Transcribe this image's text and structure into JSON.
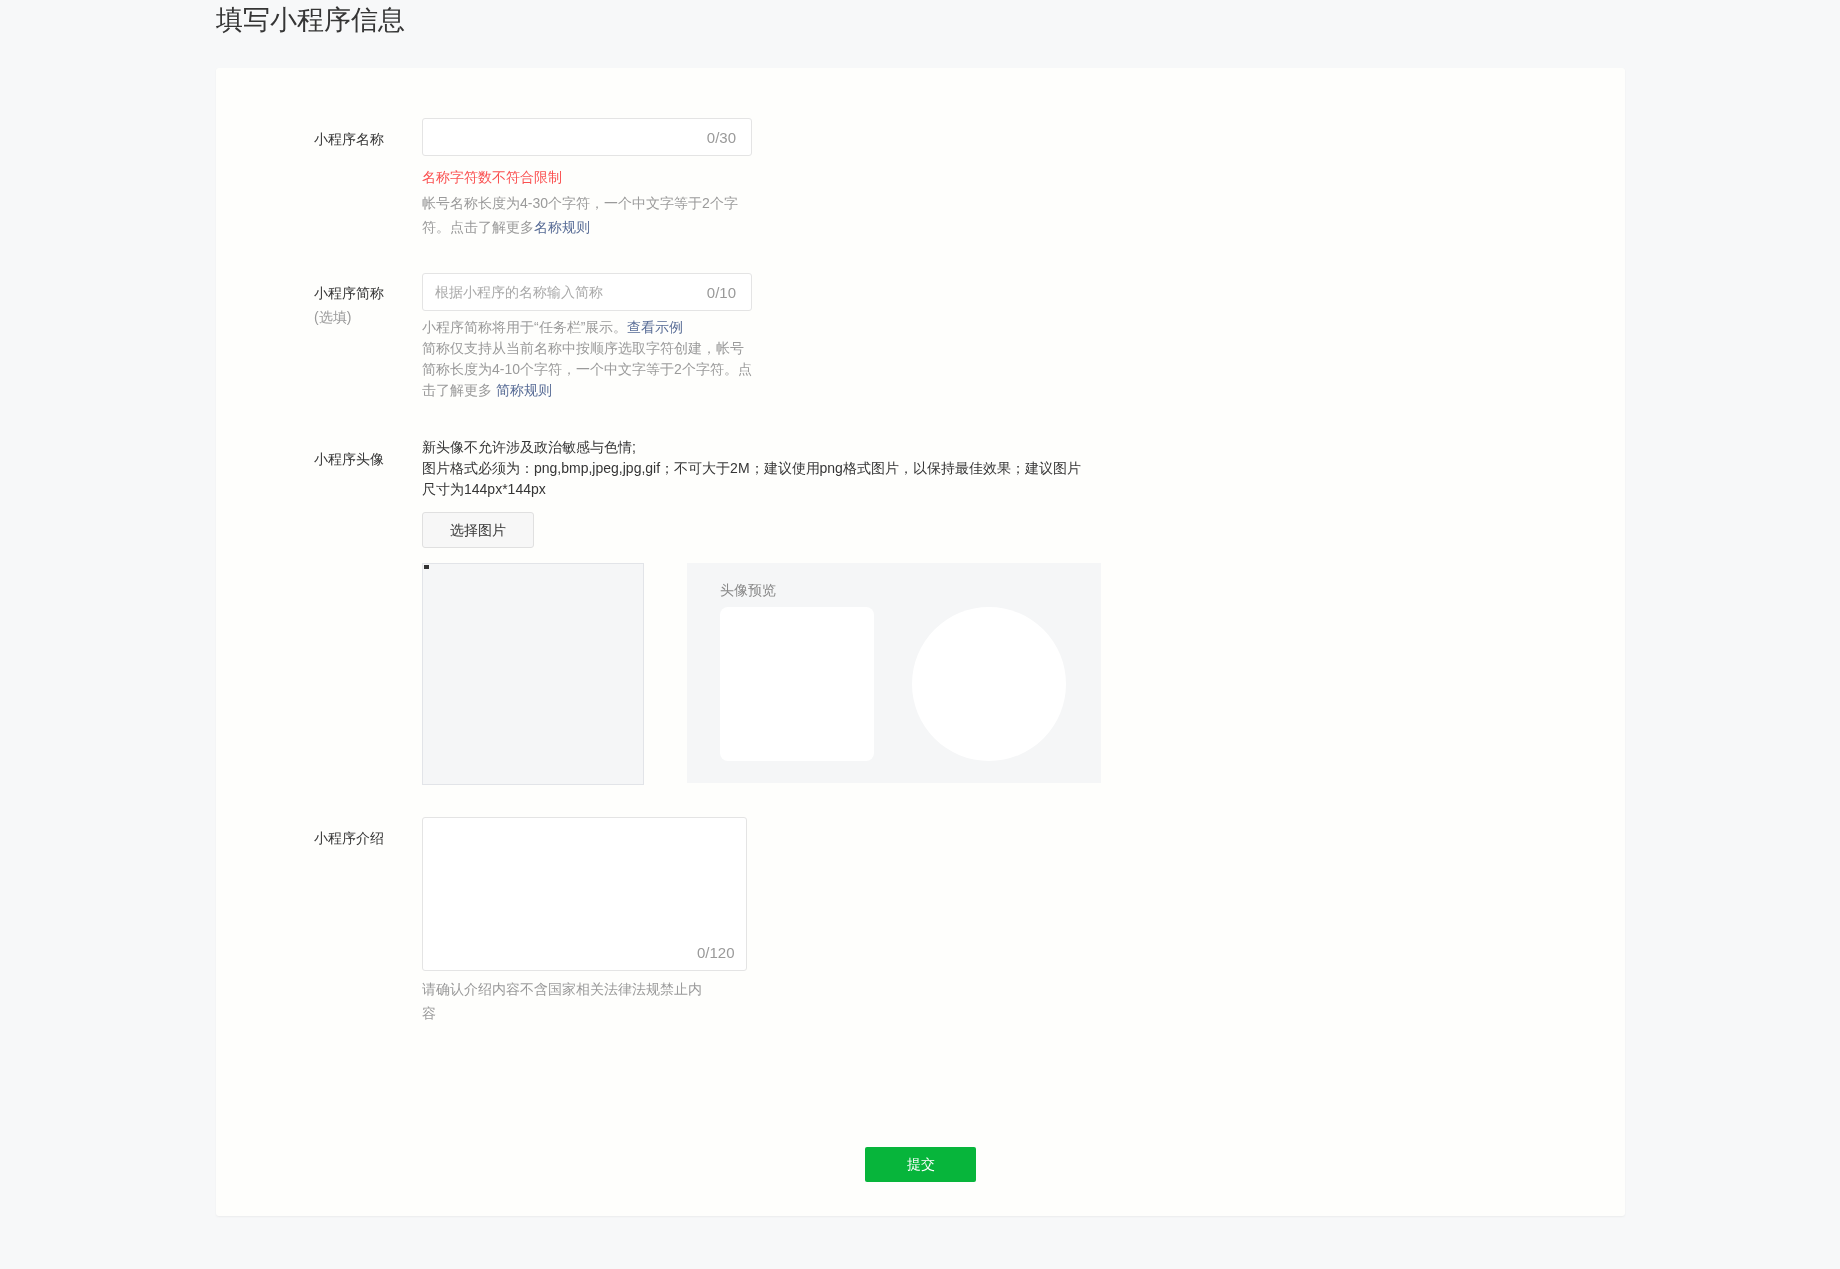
{
  "page_title": "填写小程序信息",
  "name_field": {
    "label": "小程序名称",
    "counter": "0/30",
    "error": "名称字符数不符合限制",
    "hint": "帐号名称长度为4-30个字符，一个中文字等于2个字符。点击了解更多",
    "hint_link": "名称规则"
  },
  "short_name_field": {
    "label": "小程序简称",
    "sublabel": "(选填)",
    "placeholder": "根据小程序的名称输入简称",
    "counter": "0/10",
    "hints": [
      {
        "text": "小程序简称将用于“任务栏”展示。",
        "link": "查看示例"
      },
      {
        "text": "简称仅支持从当前名称中按顺序选取字符创建，帐号简称长度为4-10个字符，一个中文字等于2个字符。点击了解更多 ",
        "link": "简称规则"
      }
    ]
  },
  "avatar_field": {
    "label": "小程序头像",
    "notes": [
      "新头像不允许涉及政治敏感与色情;",
      "图片格式必须为：png,bmp,jpeg,jpg,gif；不可大于2M；建议使用png格式图片，以保持最佳效果；建议图片尺寸为144px*144px"
    ],
    "choose_button": "选择图片",
    "preview_label": "头像预览"
  },
  "intro_field": {
    "label": "小程序介绍",
    "counter": "0/120",
    "hint": "请确认介绍内容不含国家相关法律法规禁止内容"
  },
  "submit_button": "提交"
}
